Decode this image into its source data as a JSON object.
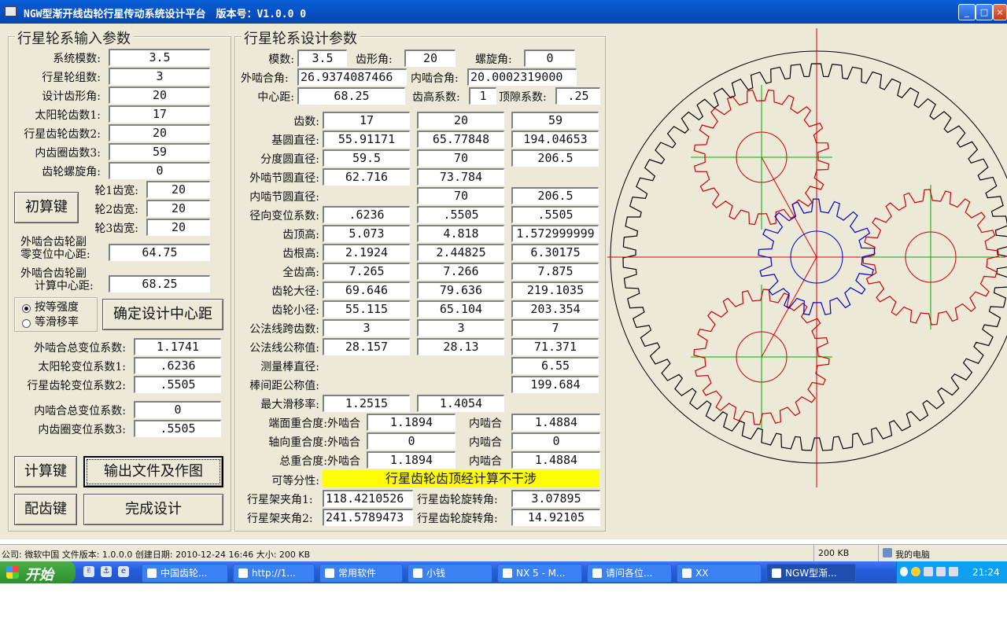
{
  "window": {
    "title": "NGW型渐开线齿轮行星传动系统设计平台　版本号：V1.0.0 0",
    "buttons": {
      "min": "_",
      "max": "□",
      "close": "×"
    }
  },
  "input_group": {
    "title": "行星轮系输入参数",
    "fields": [
      {
        "label": "系统模数:",
        "value": "3.5"
      },
      {
        "label": "行星轮组数:",
        "value": "3"
      },
      {
        "label": "设计齿形角:",
        "value": "20"
      },
      {
        "label": "太阳轮齿数1:",
        "value": "17"
      },
      {
        "label": "行星齿轮齿数2:",
        "value": "20"
      },
      {
        "label": "内齿圈齿数3:",
        "value": "59"
      },
      {
        "label": "齿轮螺旋角:",
        "value": "0"
      }
    ],
    "calc_init_button": "初算键",
    "widths": [
      {
        "label": "轮1齿宽:",
        "value": "20"
      },
      {
        "label": "轮2齿宽:",
        "value": "20"
      },
      {
        "label": "轮3齿宽:",
        "value": "20"
      }
    ],
    "zero_center_label1": "外啮合齿轮副",
    "zero_center_label2": "零变位中心距:",
    "zero_center_value": "64.75",
    "calc_center_label1": "外啮合齿轮副",
    "calc_center_label2": "计算中心距:",
    "calc_center_value": "68.25",
    "radio1": "按等强度",
    "radio2": "等滑移率",
    "confirm_button": "确定设计中心距",
    "shift": [
      {
        "label": "外啮合总变位系数:",
        "value": "1.1741"
      },
      {
        "label": "太阳轮变位系数1:",
        "value": ".6236"
      },
      {
        "label": "行星齿轮变位系数2:",
        "value": ".5505"
      },
      {
        "label": "内啮合总变位系数:",
        "value": "0"
      },
      {
        "label": "内齿圈变位系数3:",
        "value": ".5505"
      }
    ],
    "calc_button": "计算键",
    "output_button": "输出文件及作图",
    "match_button": "配齿键",
    "finish_button": "完成设计"
  },
  "design_group": {
    "title": "行星轮系设计参数",
    "module_label": "模数:",
    "module": "3.5",
    "pressure_label": "齿形角:",
    "pressure": "20",
    "helix_label": "螺旋角:",
    "helix": "0",
    "ext_angle_label": "外啮合角:",
    "ext_angle": "26.9374087466",
    "int_angle_label": "内啮合角:",
    "int_angle": "20.0002319000",
    "center_label": "中心距:",
    "center": "68.25",
    "addendum_coef_label": "齿高系数:",
    "addendum_coef": "1",
    "clearance_label": "顶隙系数:",
    "clearance": ".25",
    "table": [
      {
        "label": "齿数:",
        "c1": "17",
        "c2": "20",
        "c3": "59"
      },
      {
        "label": "基圆直径:",
        "c1": "55.91171",
        "c2": "65.77848",
        "c3": "194.04653"
      },
      {
        "label": "分度圆直径:",
        "c1": "59.5",
        "c2": "70",
        "c3": "206.5"
      },
      {
        "label": "外啮节圆直径:",
        "c1": "62.716",
        "c2": "73.784",
        "c3": ""
      },
      {
        "label": "内啮节圆直径:",
        "c1": "",
        "c2": "70",
        "c3": "206.5"
      },
      {
        "label": "径向变位系数:",
        "c1": ".6236",
        "c2": ".5505",
        "c3": ".5505"
      },
      {
        "label": "齿顶高:",
        "c1": "5.073",
        "c2": "4.818",
        "c3": "1.572999999"
      },
      {
        "label": "齿根高:",
        "c1": "2.1924",
        "c2": "2.44825",
        "c3": "6.30175"
      },
      {
        "label": "全齿高:",
        "c1": "7.265",
        "c2": "7.266",
        "c3": "7.875"
      },
      {
        "label": "齿轮大径:",
        "c1": "69.646",
        "c2": "79.636",
        "c3": "219.1035"
      },
      {
        "label": "齿轮小径:",
        "c1": "55.115",
        "c2": "65.104",
        "c3": "203.354"
      },
      {
        "label": "公法线跨齿数:",
        "c1": "3",
        "c2": "3",
        "c3": "7"
      },
      {
        "label": "公法线公称值:",
        "c1": "28.157",
        "c2": "28.13",
        "c3": "71.371"
      },
      {
        "label": "测量棒直径:",
        "c1": "",
        "c2": "",
        "c3": "6.55"
      },
      {
        "label": "棒间距公称值:",
        "c1": "",
        "c2": "",
        "c3": "199.684"
      },
      {
        "label": "最大滑移率:",
        "c1": "1.2515",
        "c2": "1.4054",
        "c3": ""
      }
    ],
    "overlap": [
      {
        "label": "端面重合度:外啮合",
        "ext": "1.1894",
        "int_label": "内啮合",
        "int": "1.4884"
      },
      {
        "label": "轴向重合度:外啮合",
        "ext": "0",
        "int_label": "内啮合",
        "int": "0"
      },
      {
        "label": "总重合度:外啮合",
        "ext": "1.1894",
        "int_label": "内啮合",
        "int": "1.4884"
      }
    ],
    "divisible_label": "可等分性:",
    "divisible_text": "行星齿轮齿顶经计算不干涉",
    "carrier1_label": "行星架夹角1:",
    "carrier1": "118.4210526",
    "carrier2_label": "行星架夹角2:",
    "carrier2": "241.5789473",
    "rot1_label": "行星齿轮旋转角:",
    "rot1": "3.07895",
    "rot2_label": "行星齿轮旋转角:",
    "rot2": "14.92105"
  },
  "gear_drawing": {
    "colors": {
      "ring": "#000000",
      "planet": "#cc0000",
      "sun": "#0000cc",
      "axis_red": "#e00000",
      "axis_green": "#00b000"
    },
    "sun_teeth": 17,
    "planet_teeth": 20,
    "ring_teeth": 59
  },
  "status": {
    "info": "公司: 微软中国 文件版本: 1.0.0.0 创建日期: 2010-12-24 16:46 大小: 200 KB",
    "size": "200 KB",
    "computer": "我的电脑"
  },
  "taskbar": {
    "start": "开始",
    "items": [
      "中国齿轮...",
      "http://1...",
      "常用软件",
      "小钱",
      "NX 5 - M...",
      "请问各位...",
      "XX",
      "NGW型渐..."
    ],
    "clock": "21:24"
  }
}
